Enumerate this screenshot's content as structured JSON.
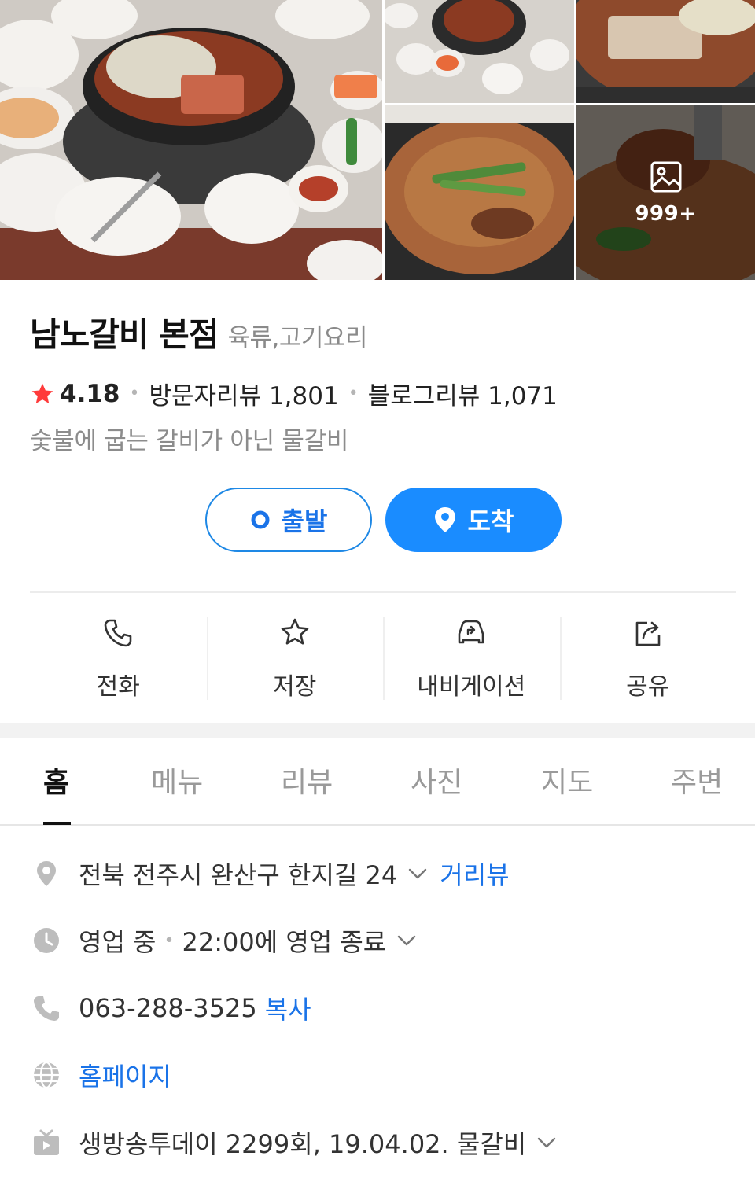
{
  "gallery": {
    "more_count": "999+"
  },
  "place": {
    "name": "남노갈비 본점",
    "category": "육류,고기요리",
    "rating": "4.18",
    "visitor_review_label": "방문자리뷰 1,801",
    "blog_review_label": "블로그리뷰 1,071",
    "description": "숯불에 굽는 갈비가 아닌 물갈비"
  },
  "route": {
    "start_label": "출발",
    "dest_label": "도착"
  },
  "actions": [
    {
      "label": "전화",
      "icon": "phone-icon"
    },
    {
      "label": "저장",
      "icon": "star-icon"
    },
    {
      "label": "내비게이션",
      "icon": "car-icon"
    },
    {
      "label": "공유",
      "icon": "share-icon"
    }
  ],
  "tabs": [
    {
      "label": "홈",
      "active": true
    },
    {
      "label": "메뉴"
    },
    {
      "label": "리뷰"
    },
    {
      "label": "사진"
    },
    {
      "label": "지도"
    },
    {
      "label": "주변"
    }
  ],
  "info": {
    "address": "전북 전주시 완산구 한지길 24",
    "street_view_label": "거리뷰",
    "status": "영업 중",
    "hours": "22:00에 영업 종료",
    "phone": "063-288-3525",
    "copy_label": "복사",
    "homepage_label": "홈페이지",
    "tv": "생방송투데이 2299회, 19.04.02. 물갈비"
  },
  "colors": {
    "accent": "#1a8cff",
    "link": "#1a73e8",
    "star": "#ff3b3b"
  }
}
